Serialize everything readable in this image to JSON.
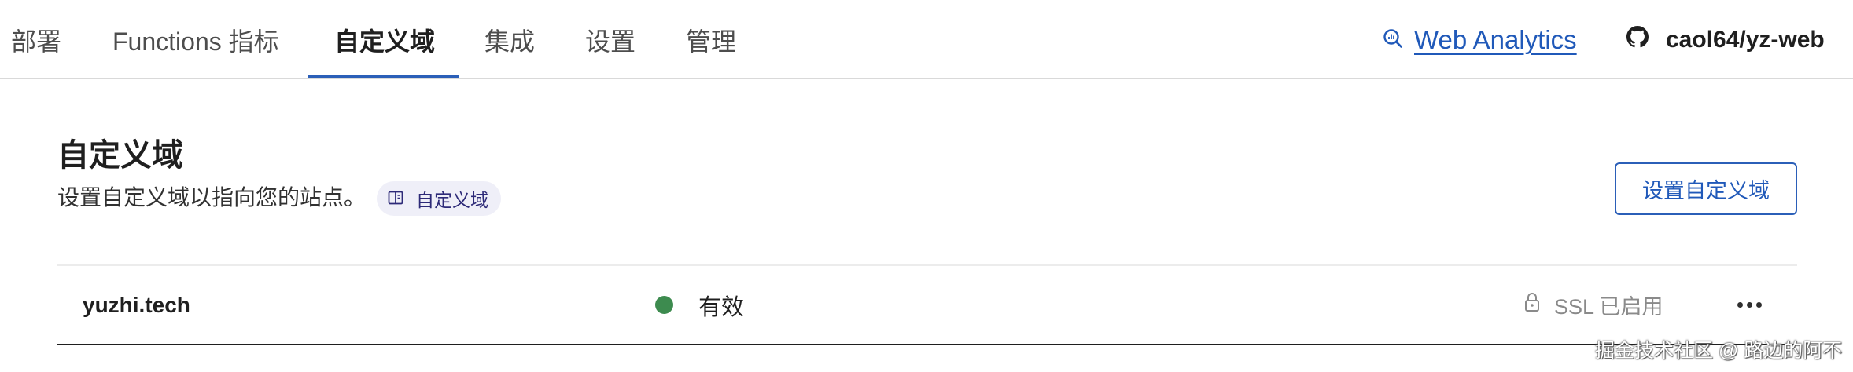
{
  "nav": {
    "tabs": [
      {
        "label": "部署"
      },
      {
        "label": "Functions 指标"
      },
      {
        "label": "自定义域"
      },
      {
        "label": "集成"
      },
      {
        "label": "设置"
      },
      {
        "label": "管理"
      }
    ],
    "active_tab": "自定义域",
    "web_analytics": {
      "label": "Web Analytics",
      "icon": "analytics-search-icon"
    },
    "repo": {
      "label": "caol64/yz-web",
      "icon": "github-icon"
    }
  },
  "section": {
    "title": "自定义域",
    "description": "设置自定义域以指向您的站点。",
    "doc_link": {
      "label": "自定义域",
      "icon": "book-icon"
    },
    "action_button": "设置自定义域"
  },
  "domains": [
    {
      "name": "yuzhi.tech",
      "status": "有效",
      "status_color": "#3d8b4f",
      "ssl": "SSL 已启用",
      "ssl_icon": "lock-icon",
      "menu_icon": "more-horizontal-icon"
    }
  ],
  "watermark": "掘金技术社区 @ 路边的阿不",
  "colors": {
    "accent": "#2b5fb8",
    "link": "#2059b9",
    "status_active": "#3d8b4f",
    "pill_bg": "#efeff8"
  }
}
